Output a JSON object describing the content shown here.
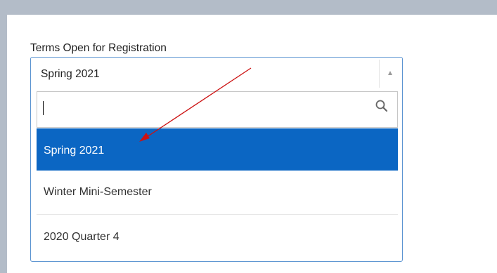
{
  "field": {
    "label": "Terms Open for Registration",
    "selected_value": "Spring 2021"
  },
  "search": {
    "value": "",
    "placeholder": ""
  },
  "options": [
    {
      "label": "Spring 2021",
      "highlighted": true
    },
    {
      "label": "Winter Mini-Semester",
      "highlighted": false
    },
    {
      "label": "2020 Quarter 4",
      "highlighted": false
    }
  ],
  "colors": {
    "frame": "#b3bcc8",
    "highlight": "#0b66c3",
    "focus_border": "#5b94d1",
    "annotation_arrow": "#cc1111"
  },
  "icons": {
    "dropdown_toggle": "triangle-up-icon",
    "search": "magnifier-icon"
  }
}
